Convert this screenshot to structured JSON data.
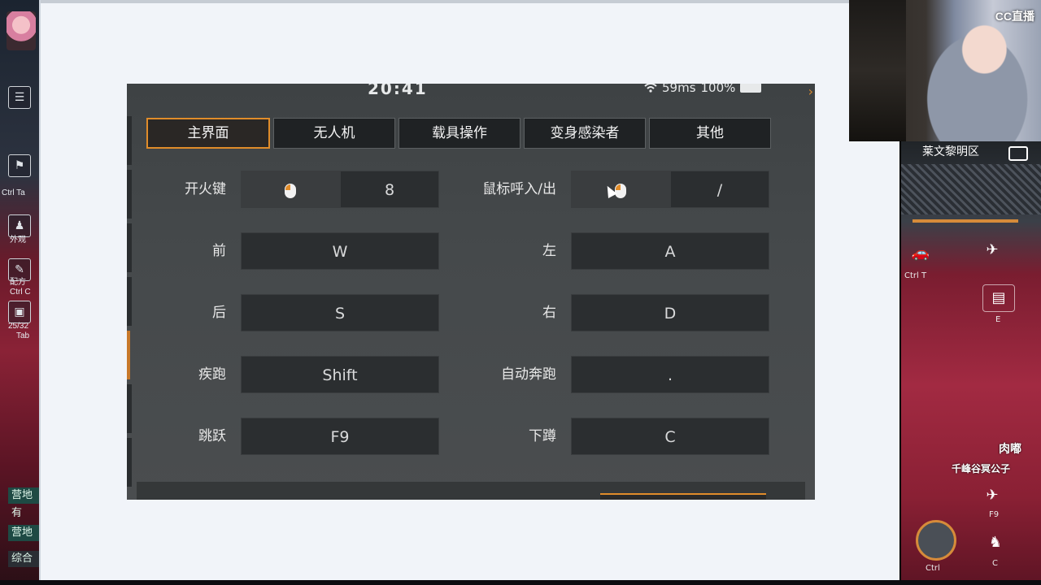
{
  "left_strip": {
    "items": [
      {
        "label": "Ctrl Ta"
      },
      {
        "label": "外观"
      },
      {
        "label": "配方"
      },
      {
        "label": "Ctrl C"
      },
      {
        "label": "25/32"
      },
      {
        "label": "Tab"
      }
    ],
    "chat_tags": [
      "营地",
      "有",
      "营地",
      "综合"
    ]
  },
  "panel": {
    "status": {
      "time": "20:41",
      "ping": "59ms",
      "battery": "100%"
    },
    "tabs": [
      {
        "label": "主界面",
        "active": true
      },
      {
        "label": "无人机",
        "active": false
      },
      {
        "label": "载具操作",
        "active": false
      },
      {
        "label": "变身感染者",
        "active": false
      },
      {
        "label": "其他",
        "active": false
      }
    ],
    "bindings": [
      {
        "left_label": "开火键",
        "left_key2": "8",
        "right_label": "鼠标呼入/出",
        "right_key2": "/"
      },
      {
        "left_label": "前",
        "left_key": "W",
        "right_label": "左",
        "right_key": "A"
      },
      {
        "left_label": "后",
        "left_key": "S",
        "right_label": "右",
        "right_key": "D"
      },
      {
        "left_label": "疾跑",
        "left_key": "Shift",
        "right_label": "自动奔跑",
        "right_key": "."
      },
      {
        "left_label": "跳跃",
        "left_key": "F9",
        "right_label": "下蹲",
        "right_key": "C"
      }
    ]
  },
  "webcam": {
    "logo": "CC直播"
  },
  "right_strip": {
    "location": "莱文黎明区",
    "labels": [
      "Ctrl T",
      "E",
      "肉嘟",
      "千峰谷冥公子",
      "F9",
      "C",
      "Ctrl"
    ]
  },
  "colors": {
    "accent": "#e08c2a",
    "panel_bg": "#45494b",
    "key_bg": "#2b2e30",
    "viewer_bg": "#f1f4f9"
  }
}
